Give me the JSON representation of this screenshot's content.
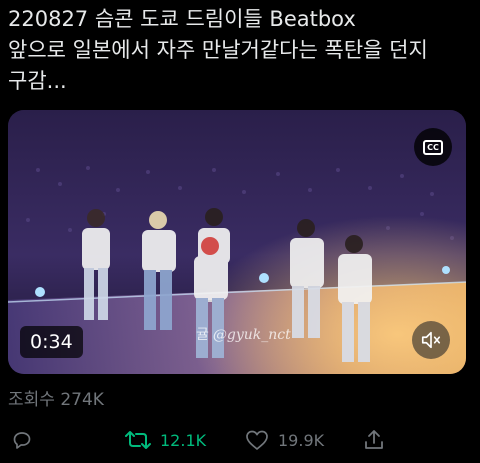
{
  "tweet": {
    "text_lines": [
      "220827 슴콘 도쿄 드림이들 Beatbox",
      "앞으로 일본에서 자주 만날거같다는 폭탄을 던지",
      "구감..."
    ]
  },
  "video": {
    "cc_label": "CC",
    "time": "0:34",
    "watermark_prefix": "귤",
    "watermark_handle": "@gyuk_nct"
  },
  "stats": {
    "views_label": "조회수",
    "views_count": "274K"
  },
  "actions": {
    "reply_icon": "reply-bubble-icon",
    "retweet_count": "12.1K",
    "like_count": "19.9K",
    "share_icon": "share-upload-icon"
  },
  "colors": {
    "background": "#000000",
    "text": "#e7e9ea",
    "muted": "#71767b",
    "retweet_active": "#00ba7c"
  }
}
